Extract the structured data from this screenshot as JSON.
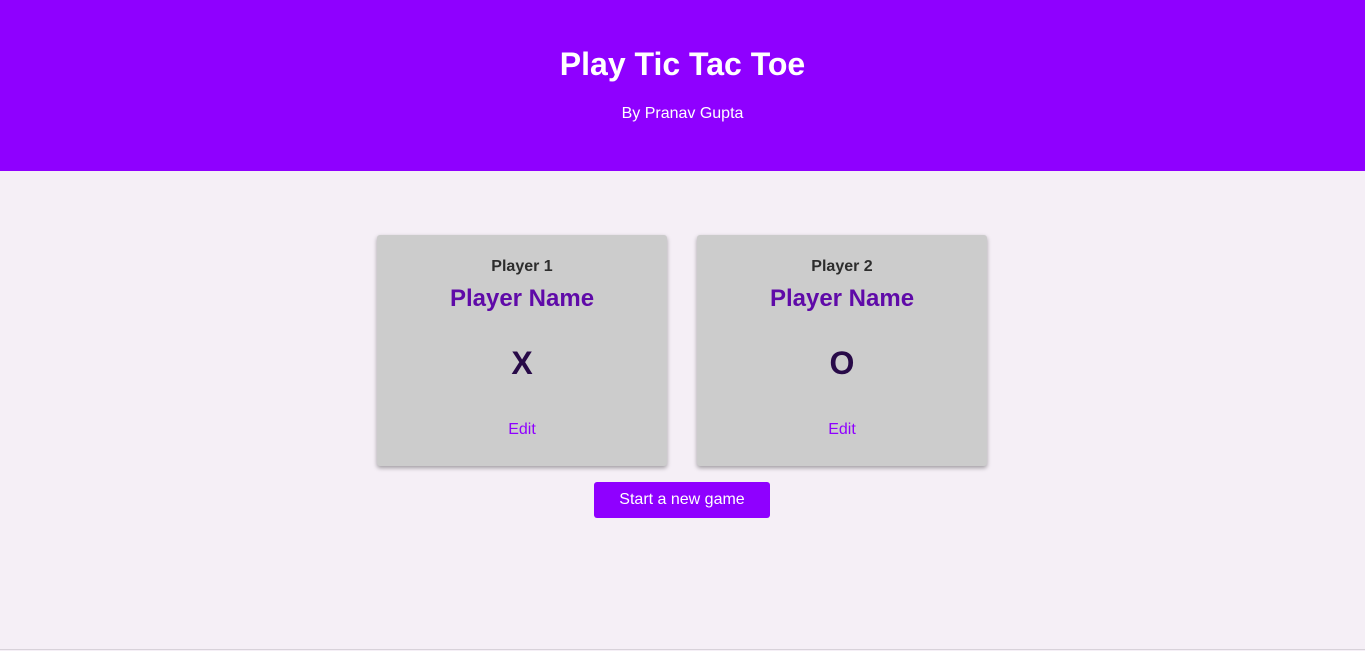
{
  "header": {
    "title": "Play Tic Tac Toe",
    "subtitle": "By Pranav Gupta"
  },
  "players": [
    {
      "label": "Player 1",
      "name": "Player Name",
      "symbol": "X",
      "edit_label": "Edit"
    },
    {
      "label": "Player 2",
      "name": "Player Name",
      "symbol": "O",
      "edit_label": "Edit"
    }
  ],
  "actions": {
    "start_label": "Start a new game"
  },
  "colors": {
    "brand": "#8f00ff",
    "background": "#f5eff6",
    "card": "#cccccc",
    "player_name": "#5f0aa8",
    "symbol": "#280a48"
  }
}
